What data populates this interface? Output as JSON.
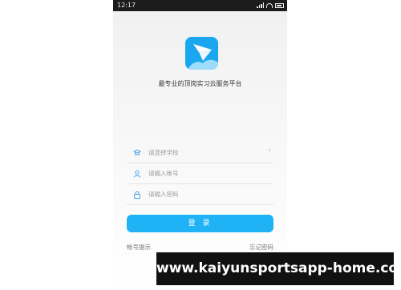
{
  "status_bar": {
    "time": "12:17"
  },
  "app": {
    "slogan": "最专业的顶岗实习云服务平台"
  },
  "form": {
    "school_placeholder": "请选择学校",
    "account_placeholder": "请输入帐号",
    "password_placeholder": "请输入密码"
  },
  "actions": {
    "login_label": "登 录",
    "account_hint": "帐号提示",
    "forgot_password": "忘记密码"
  },
  "watermark": {
    "text": "www.kaiyunsportsapp-home.com"
  },
  "colors": {
    "accent": "#1fb3f5",
    "logo": "#1aa7ef"
  },
  "icons": [
    "school-icon",
    "user-icon",
    "lock-icon",
    "chevron-right-icon",
    "paper-plane-icon"
  ]
}
